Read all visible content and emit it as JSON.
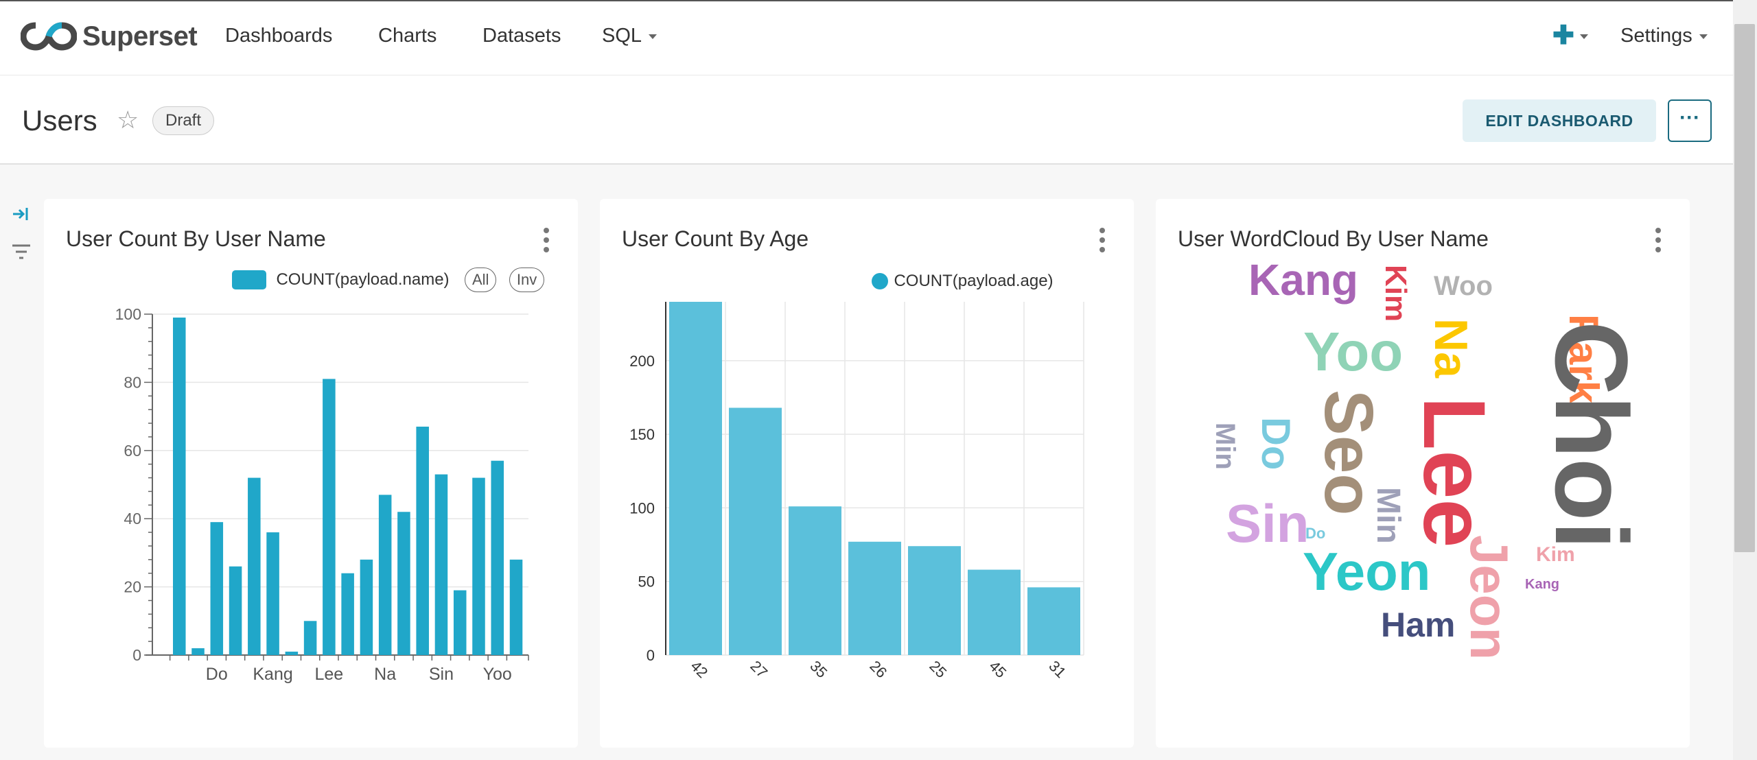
{
  "nav": {
    "brand": "Superset",
    "items": [
      "Dashboards",
      "Charts",
      "Datasets",
      "SQL"
    ],
    "settings": "Settings"
  },
  "dashboard": {
    "title": "Users",
    "status": "Draft",
    "edit_label": "EDIT DASHBOARD",
    "more_label": "···"
  },
  "icons": {
    "logo": "superset-logo",
    "plus": "plus-icon",
    "star": "star-icon",
    "expand": "expand-sidebar-icon",
    "filter": "filter-icon",
    "kebab": "more-vertical-icon"
  },
  "colors": {
    "accent": "#20a7c9",
    "bar2": "#5bc0db",
    "primary_dark": "#1a6b80"
  },
  "charts": {
    "name": {
      "title": "User Count By User Name",
      "legend": "COUNT(payload.name)",
      "all_label": "All",
      "inv_label": "Inv"
    },
    "age": {
      "title": "User Count By Age",
      "legend": "COUNT(payload.age)"
    },
    "wordcloud": {
      "title": "User WordCloud By User Name"
    }
  },
  "chart_data": [
    {
      "type": "bar",
      "title": "User Count By User Name",
      "series": [
        {
          "name": "COUNT(payload.name)",
          "values": [
            99,
            2,
            39,
            26,
            52,
            36,
            1,
            10,
            81,
            24,
            28,
            47,
            42,
            67,
            53,
            19,
            52,
            57,
            28
          ]
        }
      ],
      "categories": [
        "",
        "",
        "Do",
        "",
        "",
        "Kang",
        "",
        "",
        "Lee",
        "",
        "",
        "Na",
        "",
        "",
        "Sin",
        "",
        "",
        "Yoo",
        ""
      ],
      "ylim": [
        0,
        100
      ],
      "yticks": [
        0,
        20,
        40,
        60,
        80,
        100
      ],
      "xtick_labels": [
        "Do",
        "Kang",
        "Lee",
        "Na",
        "Sin",
        "Yoo"
      ],
      "xlabel": "",
      "ylabel": "",
      "grid": true,
      "legend_position": "top-right"
    },
    {
      "type": "bar",
      "title": "User Count By Age",
      "series": [
        {
          "name": "COUNT(payload.age)",
          "values": [
            240,
            168,
            101,
            77,
            74,
            58,
            46
          ]
        }
      ],
      "categories": [
        "42",
        "27",
        "35",
        "26",
        "25",
        "45",
        "31"
      ],
      "ylim": [
        0,
        240
      ],
      "yticks": [
        0,
        50,
        100,
        150,
        200
      ],
      "xlabel": "",
      "ylabel": "",
      "grid": true,
      "legend_position": "top-right"
    }
  ],
  "wordcloud": {
    "words": [
      {
        "text": "Kang",
        "color": "#a865b5"
      },
      {
        "text": "Kim",
        "color": "#e04355"
      },
      {
        "text": "Woo",
        "color": "#b2b2b2"
      },
      {
        "text": "Park",
        "color": "#ff7f44"
      },
      {
        "text": "Yoo",
        "color": "#8fd3b6"
      },
      {
        "text": "Na",
        "color": "#fcc700"
      },
      {
        "text": "Choi",
        "color": "#666666"
      },
      {
        "text": "Seo",
        "color": "#a38f79"
      },
      {
        "text": "Lee",
        "color": "#e04355"
      },
      {
        "text": "Min",
        "color": "#9ea0b8"
      },
      {
        "text": "Do",
        "color": "#79cade"
      },
      {
        "text": "Sin",
        "color": "#d3a3e0"
      },
      {
        "text": "Min",
        "color": "#9ea0b8"
      },
      {
        "text": "Do",
        "color": "#79cade"
      },
      {
        "text": "Kim",
        "color": "#efa1aa"
      },
      {
        "text": "Yeon",
        "color": "#2cc7c7"
      },
      {
        "text": "Jeon",
        "color": "#efa1aa"
      },
      {
        "text": "Kang",
        "color": "#a865b5"
      },
      {
        "text": "Ham",
        "color": "#454e7c"
      }
    ]
  }
}
